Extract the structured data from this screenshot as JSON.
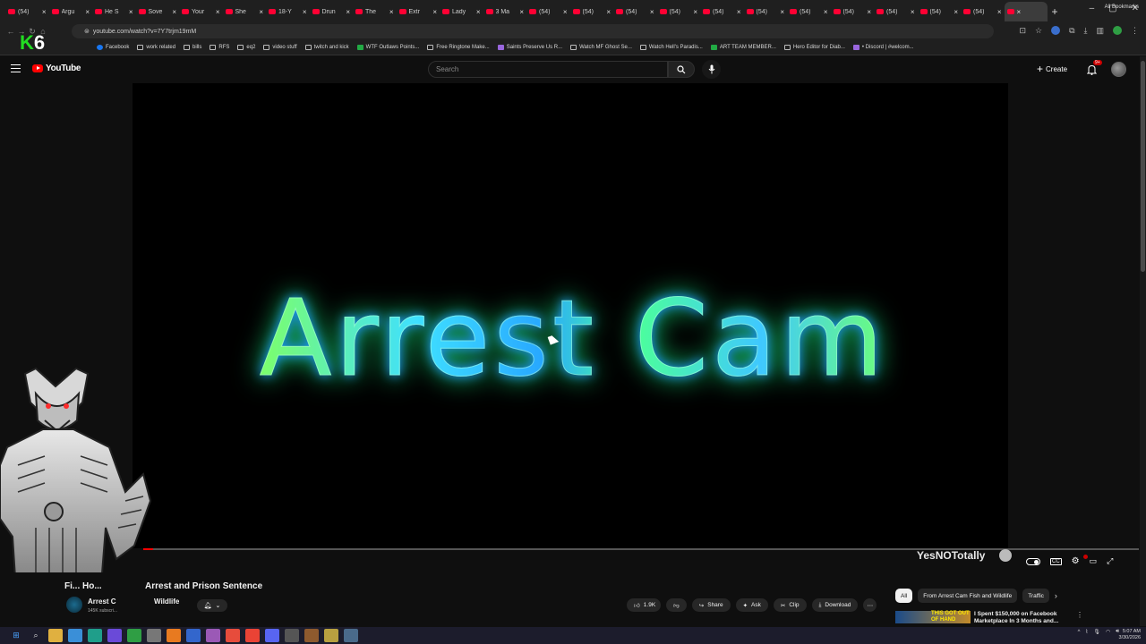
{
  "browser": {
    "tabs": [
      {
        "label": "(54)"
      },
      {
        "label": "Argu"
      },
      {
        "label": "He S"
      },
      {
        "label": "Sove"
      },
      {
        "label": "Your"
      },
      {
        "label": "She"
      },
      {
        "label": "18-Y"
      },
      {
        "label": "Drun"
      },
      {
        "label": "The"
      },
      {
        "label": "Extr"
      },
      {
        "label": "Lady"
      },
      {
        "label": "3 Ma"
      },
      {
        "label": "(54)"
      },
      {
        "label": "(54)"
      },
      {
        "label": "(54)"
      },
      {
        "label": "(54)"
      },
      {
        "label": "(54)"
      },
      {
        "label": "(54)"
      },
      {
        "label": "(54)"
      },
      {
        "label": "(54)"
      },
      {
        "label": "(54)"
      },
      {
        "label": "(54)"
      },
      {
        "label": "(54)"
      }
    ],
    "new_tab": "+",
    "url": "youtube.com/watch?v=7Y7trjm19mM",
    "bookmarks": [
      {
        "label": "Facebook",
        "icon": "fb"
      },
      {
        "label": "work related",
        "icon": "folder"
      },
      {
        "label": "bills",
        "icon": "folder"
      },
      {
        "label": "RFS",
        "icon": "folder"
      },
      {
        "label": "eq2",
        "icon": "folder"
      },
      {
        "label": "video stuff",
        "icon": "folder"
      },
      {
        "label": "twitch and kick",
        "icon": "folder"
      },
      {
        "label": "WTF Outlaws Points...",
        "icon": "g"
      },
      {
        "label": "Free Ringtone Make...",
        "icon": "folder"
      },
      {
        "label": "Saints Preserve Us R...",
        "icon": "p"
      },
      {
        "label": "Watch MF Ghost Se...",
        "icon": "folder"
      },
      {
        "label": "Watch Hell's Paradis...",
        "icon": "folder"
      },
      {
        "label": "ART TEAM MEMBER...",
        "icon": "g"
      },
      {
        "label": "Hero Editor for Diab...",
        "icon": "folder"
      },
      {
        "label": "• Discord | #welcom...",
        "icon": "p"
      }
    ],
    "all_bookmarks": "All Bookmarks"
  },
  "overlay": {
    "k": "K",
    "six": "6",
    "watermark": "YesNOTotally"
  },
  "youtube": {
    "logo_text": "YouTube",
    "search_placeholder": "Search",
    "create_label": "Create",
    "notif_badge": "9+"
  },
  "player": {
    "title_card_text": "Arrest Cam",
    "progress_fraction": 0.01
  },
  "video": {
    "title_left": "Fi... Ho...",
    "title": "Arrest and Prison Sentence",
    "channel_short": "Arrest C",
    "channel_rest": "Wildlife",
    "subscribers": "145K subscri...",
    "likes": "1.9K",
    "share_label": "Share",
    "ask_label": "Ask",
    "clip_label": "Clip",
    "download_label": "Download"
  },
  "sidebar": {
    "chips": [
      {
        "label": "All",
        "selected": true
      },
      {
        "label": "From Arrest Cam Fish and Wildlife",
        "selected": false
      },
      {
        "label": "Traffic",
        "selected": false
      }
    ],
    "rec_title": "I Spent $150,000 on Facebook Marketplace In 3 Months and...",
    "rec_thumb_text": "THIS GOT OUT OF HAND"
  },
  "taskbar": {
    "time": "5:07 AM",
    "date": "3/30/2026"
  },
  "colors": {
    "accent": "#ff0000",
    "bg": "#0f0f0f",
    "chip_bg": "#272727"
  }
}
